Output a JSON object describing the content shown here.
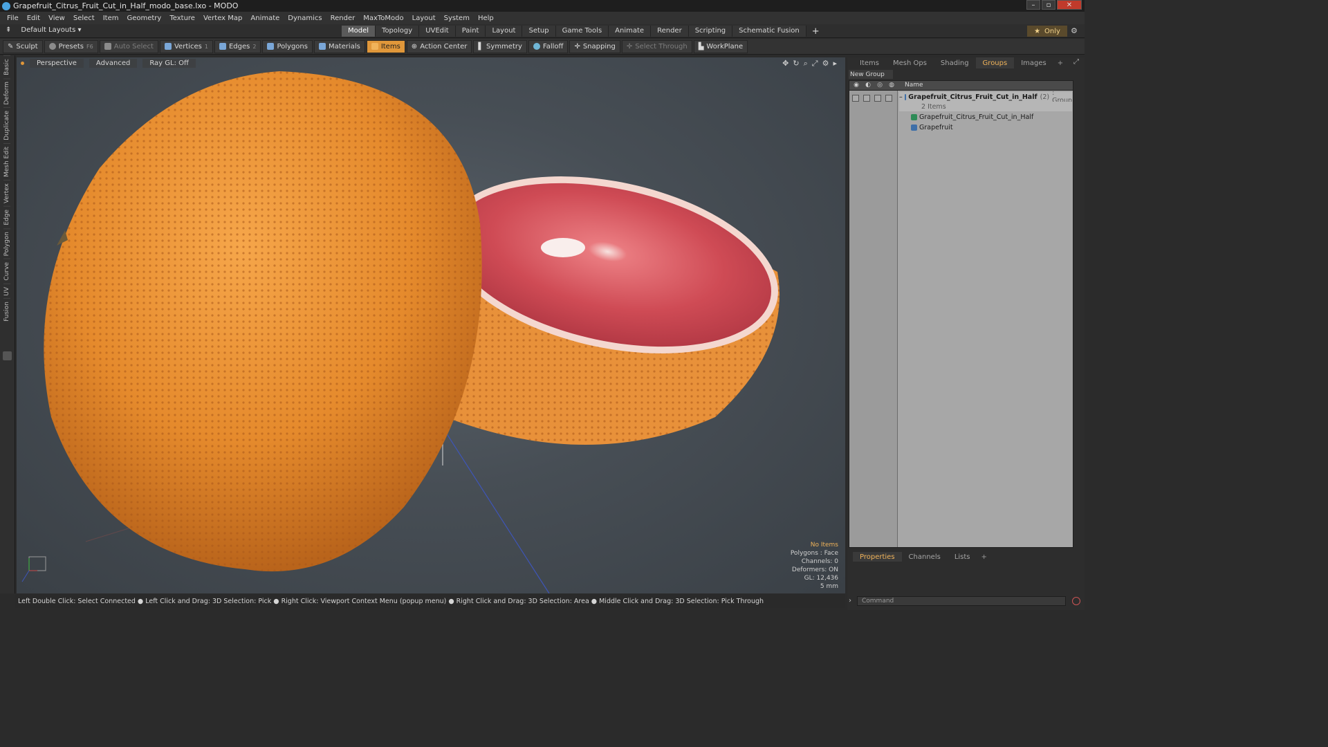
{
  "window": {
    "title": "Grapefruit_Citrus_Fruit_Cut_in_Half_modo_base.lxo - MODO",
    "controls": [
      "–",
      "▫",
      "✕"
    ]
  },
  "menu": [
    "File",
    "Edit",
    "View",
    "Select",
    "Item",
    "Geometry",
    "Texture",
    "Vertex Map",
    "Animate",
    "Dynamics",
    "Render",
    "MaxToModo",
    "Layout",
    "System",
    "Help"
  ],
  "layout": {
    "selector": "Default Layouts ▾",
    "tabs": [
      "Model",
      "Topology",
      "UVEdit",
      "Paint",
      "Layout",
      "Setup",
      "Game Tools",
      "Animate",
      "Render",
      "Scripting",
      "Schematic Fusion"
    ],
    "active_tab": "Model",
    "plus": "+",
    "only_label": "Only",
    "star": "★"
  },
  "toolbar": {
    "sculpt": "Sculpt",
    "presets": "Presets",
    "presets_key": "F6",
    "auto_select": "Auto Select",
    "vertices": "Vertices",
    "vertices_key": "1",
    "edges": "Edges",
    "edges_key": "2",
    "polygons": "Polygons",
    "materials": "Materials",
    "items": "Items",
    "action_center": "Action Center",
    "symmetry": "Symmetry",
    "falloff": "Falloff",
    "snapping": "Snapping",
    "select_through": "Select Through",
    "workplane": "WorkPlane"
  },
  "left_tabs": [
    "Basic",
    "Deform",
    "Duplicate",
    "Mesh Edit",
    "Vertex",
    "Edge",
    "Polygon",
    "Curve",
    "UV",
    "Fusion"
  ],
  "viewport": {
    "view": "Perspective",
    "shading": "Advanced",
    "raygl": "Ray GL: Off",
    "info": {
      "no_items": "No Items",
      "polygons": "Polygons : Face",
      "channels": "Channels: 0",
      "deformers": "Deformers: ON",
      "gl": "GL: 12,436",
      "scale": "5 mm"
    }
  },
  "status": "Left Double Click: Select Connected ● Left Click and Drag: 3D Selection: Pick ● Right Click: Viewport Context Menu (popup menu) ● Right Click and Drag: 3D Selection: Area ● Middle Click and Drag: 3D Selection: Pick Through",
  "right_panel": {
    "tabs": [
      "Items",
      "Mesh Ops",
      "Shading",
      "Groups",
      "Images"
    ],
    "active_tab": "Groups",
    "new_group": "New Group",
    "name_header": "Name",
    "group": {
      "name": "Grapefruit_Citrus_Fruit_Cut_in_Half",
      "count": "(2)",
      "type": ": Group",
      "items_label": "2 Items",
      "children": [
        "Grapefruit_Citrus_Fruit_Cut_in_Half",
        "Grapefruit"
      ]
    }
  },
  "lower_panel": {
    "tabs": [
      "Properties",
      "Channels",
      "Lists"
    ],
    "active_tab": "Properties",
    "command_placeholder": "Command"
  }
}
